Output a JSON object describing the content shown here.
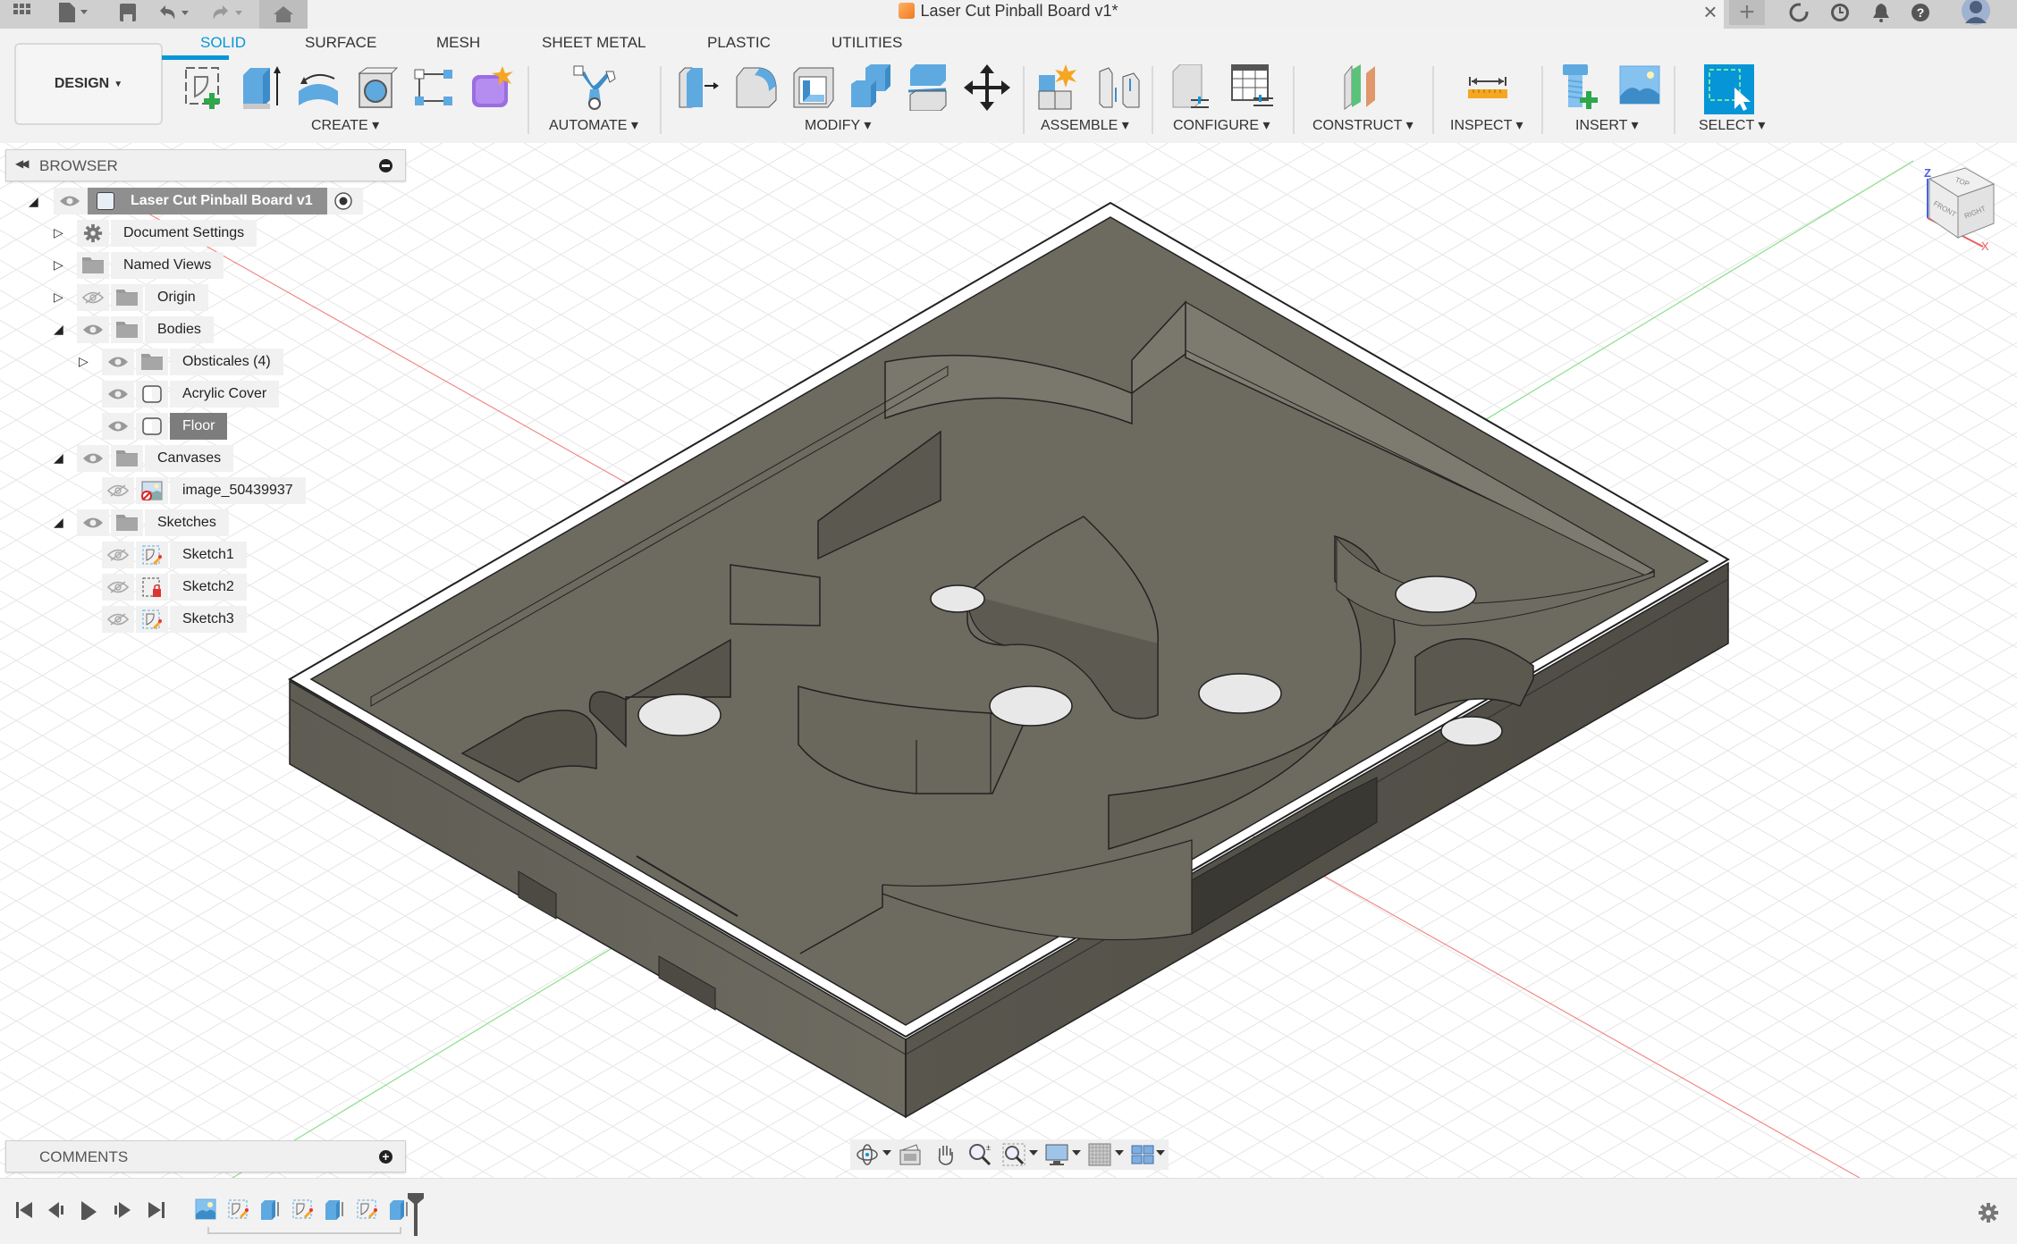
{
  "window": {
    "title": "Laser Cut Pinball Board v1*",
    "quick_access": [
      {
        "name": "data-panel",
        "icon": "grid-icon"
      },
      {
        "name": "file",
        "icon": "file-icon"
      },
      {
        "name": "save",
        "icon": "save-icon"
      },
      {
        "name": "undo",
        "icon": "undo-icon"
      },
      {
        "name": "redo",
        "icon": "redo-icon"
      },
      {
        "name": "home",
        "icon": "home-icon"
      }
    ],
    "right_icons": [
      "new-tab-icon",
      "extensions-icon",
      "job-status-icon",
      "notifications-icon",
      "help-icon",
      "user-avatar-icon"
    ]
  },
  "toolbar": {
    "workspace_label": "DESIGN",
    "tabs": [
      {
        "label": "SOLID",
        "active": true
      },
      {
        "label": "SURFACE",
        "active": false
      },
      {
        "label": "MESH",
        "active": false
      },
      {
        "label": "SHEET METAL",
        "active": false
      },
      {
        "label": "PLASTIC",
        "active": false
      },
      {
        "label": "UTILITIES",
        "active": false
      }
    ],
    "groups": [
      {
        "label": "CREATE",
        "tools": [
          "create-sketch",
          "extrude",
          "revolve",
          "hole",
          "pattern",
          "create-form"
        ]
      },
      {
        "label": "AUTOMATE",
        "tools": [
          "automate"
        ]
      },
      {
        "label": "MODIFY",
        "tools": [
          "press-pull",
          "fillet",
          "shell",
          "combine",
          "split-body",
          "move-copy"
        ]
      },
      {
        "label": "ASSEMBLE",
        "tools": [
          "new-component",
          "joint"
        ]
      },
      {
        "label": "CONFIGURE",
        "tools": [
          "configure-model",
          "configuration-table"
        ]
      },
      {
        "label": "CONSTRUCT",
        "tools": [
          "offset-plane"
        ]
      },
      {
        "label": "INSPECT",
        "tools": [
          "measure"
        ]
      },
      {
        "label": "INSERT",
        "tools": [
          "insert-mcmaster",
          "insert-canvas"
        ]
      },
      {
        "label": "SELECT",
        "tools": [
          "window-select"
        ]
      }
    ],
    "accent": "#0696d7"
  },
  "browser": {
    "title": "BROWSER",
    "root": {
      "label": "Laser Cut Pinball Board v1"
    },
    "items": [
      {
        "label": "Document Settings",
        "icon": "gear-icon",
        "visibility": "none",
        "expander": "collapsed",
        "level": 1
      },
      {
        "label": "Named Views",
        "icon": "folder-icon",
        "visibility": "none",
        "expander": "collapsed",
        "level": 1
      },
      {
        "label": "Origin",
        "icon": "folder-icon",
        "visibility": "hidden",
        "expander": "collapsed",
        "level": 1
      },
      {
        "label": "Bodies",
        "icon": "folder-icon",
        "visibility": "visible",
        "expander": "expanded",
        "level": 1
      },
      {
        "label": "Obsticales (4)",
        "icon": "folder-icon",
        "visibility": "visible",
        "expander": "collapsed",
        "level": 2
      },
      {
        "label": "Acrylic Cover",
        "icon": "body-icon",
        "visibility": "visible",
        "expander": "none",
        "level": 2
      },
      {
        "label": "Floor",
        "icon": "body-icon",
        "visibility": "visible",
        "expander": "none",
        "level": 2,
        "selected": true
      },
      {
        "label": "Canvases",
        "icon": "folder-icon",
        "visibility": "visible",
        "expander": "expanded",
        "level": 1
      },
      {
        "label": "image_50439937",
        "icon": "canvas-image-icon",
        "visibility": "hidden",
        "expander": "none",
        "level": 2
      },
      {
        "label": "Sketches",
        "icon": "folder-icon",
        "visibility": "visible",
        "expander": "expanded",
        "level": 1
      },
      {
        "label": "Sketch1",
        "icon": "sketch-icon",
        "visibility": "hidden",
        "expander": "none",
        "level": 2
      },
      {
        "label": "Sketch2",
        "icon": "sketch-locked-icon",
        "visibility": "hidden",
        "expander": "none",
        "level": 2
      },
      {
        "label": "Sketch3",
        "icon": "sketch-icon",
        "visibility": "hidden",
        "expander": "none",
        "level": 2
      }
    ]
  },
  "comments": {
    "title": "COMMENTS"
  },
  "viewcube": {
    "top": "TOP",
    "front": "FRONT",
    "right": "RIGHT",
    "axis_z": "Z",
    "axis_x": "X"
  },
  "navbar": {
    "tools": [
      "orbit-icon",
      "look-at-icon",
      "pan-icon",
      "zoom-icon",
      "fit-icon",
      "display-settings-icon",
      "grid-settings-icon",
      "viewports-icon"
    ]
  },
  "timeline": {
    "controls": [
      "go-to-start",
      "step-back",
      "play",
      "step-forward",
      "go-to-end"
    ],
    "features": [
      "canvas",
      "sketch",
      "extrude",
      "sketch",
      "extrude",
      "sketch",
      "extrude"
    ]
  },
  "model": {
    "body_color": "#6d6a60",
    "floor_color": "#6b685e",
    "wall_color": "#545248"
  }
}
